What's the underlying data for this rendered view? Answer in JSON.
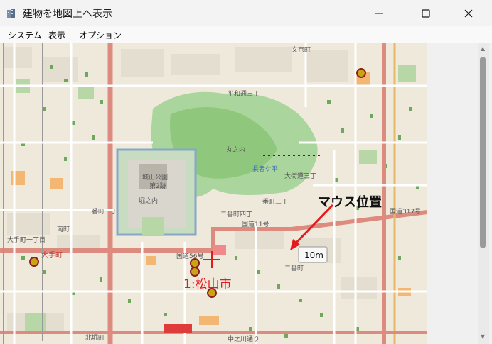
{
  "window": {
    "title": "建物を地図上へ表示"
  },
  "menu": {
    "items": [
      "システム",
      "表示",
      "オプション"
    ]
  },
  "map": {
    "mouse_label": "マウス位置",
    "scale_label": "10m",
    "center_label": "1:松山市",
    "place_labels": {
      "castle_park": "城山公園",
      "ward2": "第2跡",
      "horinouchi": "堀之内",
      "marunouchi": "丸之内",
      "nagatoheira": "長者ケ平",
      "otemachi": "大手町",
      "takano": "大手町一丁目",
      "nibancho4": "二番町四丁",
      "national_route": "国道11号",
      "route56": "国道56号",
      "route317": "国道317号",
      "heiwadori": "平和通三丁",
      "bunkyo": "文京町",
      "minami": "南町",
      "ichibancho3": "一番町三丁",
      "ichibancho1": "一番町一丁",
      "nibancho": "二番町",
      "okaido": "大街道三丁",
      "kitahoricho": "北堀町",
      "kukasho": "中之川通り"
    },
    "colors": {
      "marker": "#e41a1c",
      "road": "#e28a80",
      "park": "#b9dbaa",
      "building": "#55a041"
    }
  }
}
